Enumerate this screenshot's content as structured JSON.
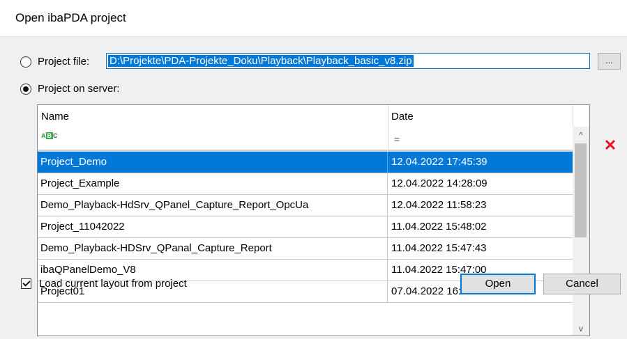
{
  "window": {
    "title": "Open ibaPDA project"
  },
  "project_file": {
    "label": "Project file:",
    "path": "D:\\Projekte\\PDA-Projekte_Doku\\Playback\\Playback_basic_v8.zip",
    "browse_label": "...",
    "selected": false
  },
  "project_server": {
    "label": "Project on server:",
    "selected": true
  },
  "table": {
    "columns": [
      "Name",
      "Date"
    ],
    "filter_name_icon": "abc-filter-icon",
    "filter_date_symbol": "=",
    "rows": [
      {
        "name": "Project_Demo",
        "date": "12.04.2022 17:45:39",
        "selected": true
      },
      {
        "name": "Project_Example",
        "date": "12.04.2022 14:28:09",
        "selected": false
      },
      {
        "name": "Demo_Playback-HdSrv_QPanel_Capture_Report_OpcUa",
        "date": "12.04.2022 11:58:23",
        "selected": false
      },
      {
        "name": "Project_11042022",
        "date": "11.04.2022 15:48:02",
        "selected": false
      },
      {
        "name": "Demo_Playback-HDSrv_QPanal_Capture_Report",
        "date": "11.04.2022 15:47:43",
        "selected": false
      },
      {
        "name": "ibaQPanelDemo_V8",
        "date": "11.04.2022 15:47:00",
        "selected": false
      },
      {
        "name": "Project01",
        "date": "07.04.2022 16:33:51",
        "selected": false
      }
    ]
  },
  "scroll": {
    "up": "^",
    "down": "v"
  },
  "delete": {
    "glyph": "✕",
    "icon": "delete-x-icon",
    "color": "#e81123"
  },
  "load_layout": {
    "label": "Load current layout from project",
    "checked": true
  },
  "buttons": {
    "open": "Open",
    "cancel": "Cancel"
  },
  "colors": {
    "accent": "#0078d7"
  }
}
